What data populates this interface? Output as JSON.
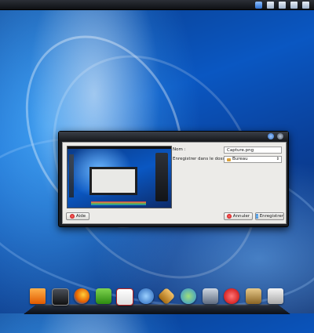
{
  "desktop": {
    "dialog": {
      "title": "",
      "name_label": "Nom :",
      "name_value": "Capture.png",
      "folder_label": "Enregistrer dans le dossier :",
      "folder_value": "Bureau",
      "help_label": "Aide",
      "cancel_label": "Annuler",
      "save_label": "Enregistrer"
    },
    "colors": {
      "wallpaper_dark": "#0c2b6a",
      "wallpaper_light": "#3f9ef0",
      "dialog_frame": "#1a1d22",
      "dialog_bg": "#ecebe8"
    },
    "dock": {
      "icons": [
        "vlc-icon",
        "monitor-icon",
        "firefox-icon",
        "settings-icon",
        "gmail-icon",
        "terminal-icon",
        "inkscape-icon",
        "chat-icon",
        "mail-send-icon",
        "media-player-icon",
        "archive-icon",
        "screenshot-icon"
      ]
    },
    "top_widgets": [
      "music-widget-icon",
      "widget-icon",
      "widget-icon",
      "widget-icon",
      "widget-icon"
    ]
  }
}
